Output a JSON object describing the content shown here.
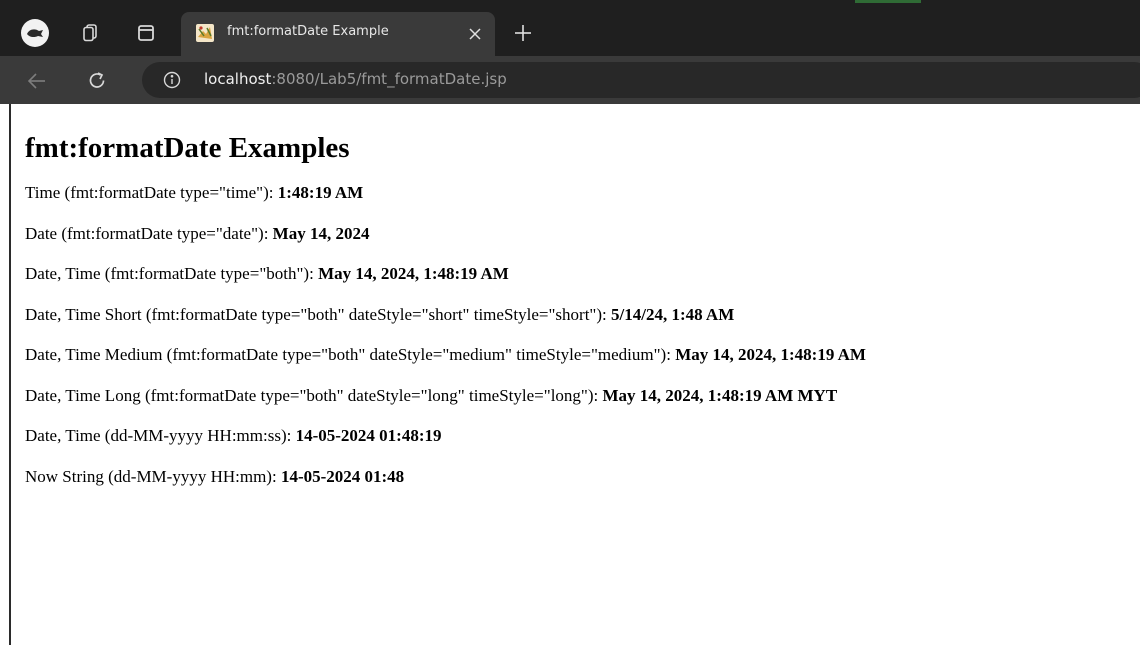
{
  "browser": {
    "tab": {
      "title": "fmt:formatDate Example",
      "favicon": "tomcat-favicon"
    },
    "address": {
      "host": "localhost",
      "rest": ":8080/Lab5/fmt_formatDate.jsp"
    },
    "icons": {
      "profile": "profile-icon",
      "workspaces": "tab-groups-icon",
      "vertical_tabs": "vertical-tabs-icon",
      "close": "close-icon",
      "new_tab": "plus-icon",
      "back": "back-arrow-icon",
      "reload": "reload-icon",
      "site_info": "info-icon"
    },
    "colors": {
      "tabbar": "#1f1f1f",
      "toolbar": "#3a3a3a",
      "omnibox": "#282828"
    }
  },
  "page": {
    "heading": "fmt:formatDate Examples",
    "lines": [
      {
        "label": "Time (fmt:formatDate type=\"time\"): ",
        "value": "1:48:19 AM"
      },
      {
        "label": "Date (fmt:formatDate type=\"date\"): ",
        "value": "May 14, 2024"
      },
      {
        "label": "Date, Time (fmt:formatDate type=\"both\"): ",
        "value": "May 14, 2024, 1:48:19 AM"
      },
      {
        "label": "Date, Time Short (fmt:formatDate type=\"both\" dateStyle=\"short\" timeStyle=\"short\"): ",
        "value": "5/14/24, 1:48 AM"
      },
      {
        "label": "Date, Time Medium (fmt:formatDate type=\"both\" dateStyle=\"medium\" timeStyle=\"medium\"): ",
        "value": "May 14, 2024, 1:48:19 AM"
      },
      {
        "label": "Date, Time Long (fmt:formatDate type=\"both\" dateStyle=\"long\" timeStyle=\"long\"): ",
        "value": "May 14, 2024, 1:48:19 AM MYT"
      },
      {
        "label": "Date, Time (dd-MM-yyyy HH:mm:ss): ",
        "value": "14-05-2024 01:48:19"
      },
      {
        "label": "Now String (dd-MM-yyyy HH:mm): ",
        "value": "14-05-2024 01:48"
      }
    ]
  }
}
